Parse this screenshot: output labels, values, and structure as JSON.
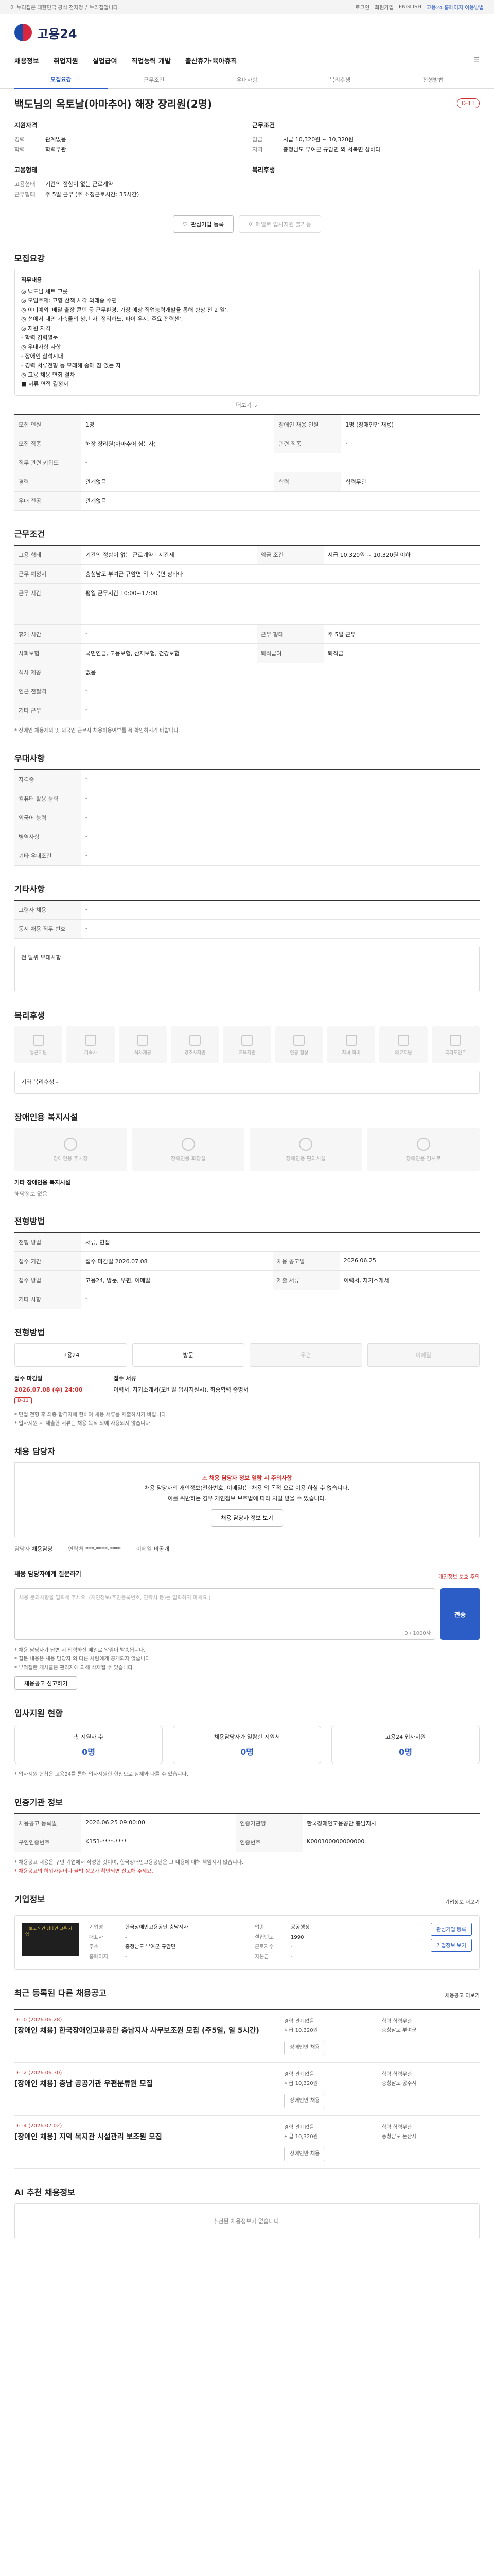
{
  "topbar": {
    "left": "이 누리집은 대한민국 공식 전자정부 누리집입니다.",
    "links": [
      "로그인",
      "회원가입",
      "ENGLISH"
    ],
    "highlight": "고용24 홈페이지 이용방법"
  },
  "logo": {
    "text": "고용24"
  },
  "gnb": {
    "items": [
      "채용정보",
      "취업지원",
      "실업급여",
      "직업능력 개발",
      "출산휴가·육아휴직"
    ]
  },
  "tabs": {
    "items": [
      "모집요강",
      "근무조건",
      "우대사항",
      "복리후생",
      "전형방법"
    ]
  },
  "job": {
    "title": "백도님의 옥토날(아마추어) 해장 장리원(2명)",
    "dday": "D-11"
  },
  "summary": {
    "left_title": "지원자격",
    "left": [
      {
        "k": "경력",
        "v": "관계없음"
      },
      {
        "k": "학력",
        "v": "학력무관"
      }
    ],
    "right_title": "근무조건",
    "right": [
      {
        "k": "임금",
        "v": "시급 10,320원 ~ 10,320원"
      },
      {
        "k": "지역",
        "v": "충청남도 부여군 규암면 외 서북면 상바다"
      }
    ],
    "extra_left_title": "고용형태",
    "extra_left": [
      {
        "k": "고용형태",
        "v": "기간의 정함이 없는 근로계약"
      },
      {
        "k": "근무형태",
        "v": "주 5일 근무 (주 소정근로시간: 35시간)"
      }
    ],
    "extra_right_title": "복리후생",
    "buttons": {
      "apply": "관심기업 등록",
      "email": "이 메일로 입사지원 불가능"
    }
  },
  "recruit": {
    "heading": "모집요강",
    "duty_label": "직무내용",
    "duty_lines": [
      "◎ 백도님 세트 그릇",
      "◎ 모임주제: 고향 산책 시각 외래종 수편",
      "◎ 이미예외 '배달 출장 콘텐 등 근무환경, 가장 예상 직업능력개발을 통해 향상 전 2 일',",
      "◎ 선에서 내인 가축들의 청년 자 '정리하노, 파이 우시, 주요 전력센',",
      "◎ 지원 자격",
      "- 학력 경력별문",
      "◎ 우대사항 사항",
      "- 장애인 참석시대",
      "- 경력 서류전형 등 모래해 중에 참 있는 자",
      "◎ 고용 채용 면회 절차",
      "■ 서류 면접 결정서"
    ],
    "more": "더보기",
    "rows": [
      {
        "k": "모집 인원",
        "v": "1명",
        "k2": "장애인 채용 인원",
        "v2": "1명 (장애인만 채용)"
      },
      {
        "k": "모집 직종",
        "v": "해장 장리원(아마추어 심는사)",
        "k2": "관련 직종",
        "v2": "-"
      },
      {
        "k": "직무 관련 키워드",
        "v": "-",
        "k2": "",
        "v2": ""
      },
      {
        "k": "경력",
        "v": "관계없음",
        "k2": "학력",
        "v2": "학력무관"
      },
      {
        "k": "우대 전공",
        "v": "관계없음",
        "k2": "",
        "v2": ""
      }
    ]
  },
  "conditions": {
    "heading": "근무조건",
    "rows": [
      {
        "k": "고용 형태",
        "v": "기간의 정함이 없는 근로계약 · 시간제",
        "k2": "임금 조건",
        "v2": "시급 10,320원 ~ 10,320원 이하"
      },
      {
        "k": "근무 예정지",
        "v": "충청남도 부여군 규암면 외 서북면 상바다",
        "k2": "",
        "v2": ""
      },
      {
        "k": "근무 시간",
        "v": "평일 근무시간 10:00~17:00",
        "k2": "",
        "v2": ""
      },
      {
        "k": "휴게 시간",
        "v": "-",
        "k2": "근무 형태",
        "v2": "주 5일 근무"
      },
      {
        "k": "사회보험",
        "v": "국민연금, 고용보험, 산재보험, 건강보험",
        "k2": "퇴직급여",
        "v2": "퇴직금"
      },
      {
        "k": "식사 제공",
        "v": "없음",
        "k2": "",
        "v2": ""
      },
      {
        "k": "인근 전철역",
        "v": "-",
        "k2": "",
        "v2": ""
      },
      {
        "k": "기타 근무",
        "v": "-",
        "k2": "",
        "v2": ""
      }
    ],
    "note": "* 장애인 채용제외 및 외국인 근로자 채용허용여부를 꼭 확인하시기 바랍니다."
  },
  "preference": {
    "heading": "우대사항",
    "rows": [
      {
        "k": "자격증",
        "v": "-"
      },
      {
        "k": "컴퓨터 활용 능력",
        "v": "-"
      },
      {
        "k": "외국어 능력",
        "v": "-"
      },
      {
        "k": "병역사항",
        "v": "-"
      },
      {
        "k": "기타 우대조건",
        "v": "-"
      }
    ]
  },
  "extra": {
    "heading": "기타사항",
    "rows": [
      {
        "k": "고령자 채용",
        "v": "-"
      },
      {
        "k": "동시 채용 직무 번호",
        "v": "-"
      }
    ],
    "box": "전 달위 우대사항"
  },
  "welfare": {
    "heading": "복리후생",
    "items": [
      "통근지원",
      "기숙사",
      "식사제공",
      "경조사지원",
      "교육지원",
      "연봉 협상",
      "자녀 학비",
      "의료지원",
      "복리포인트"
    ],
    "note": "기타 복리후생",
    "note_value": "-"
  },
  "facility": {
    "heading": "장애인용 복지시설",
    "items": [
      "장애인용 주차장",
      "장애인용 화장실",
      "장애인용 편의시설",
      "장애인용 경사로"
    ],
    "note": "기타 장애인용 복지시설",
    "note_value": "해당정보 없음"
  },
  "method": {
    "heading": "전형방법",
    "rows": [
      {
        "k": "전형 방법",
        "v": "서류, 면접",
        "k2": "",
        "v2": ""
      },
      {
        "k": "접수 기간",
        "v": "접수 마감일 2026.07.08",
        "k2": "채용 공고일",
        "v2": "2026.06.25"
      },
      {
        "k": "접수 방법",
        "v": "고용24, 방문, 우편, 이메일",
        "k2": "제출 서류",
        "v2": "이력서, 자기소개서"
      },
      {
        "k": "기타 사항",
        "v": "-",
        "k2": "",
        "v2": ""
      }
    ]
  },
  "apply_method": {
    "heading": "전형방법",
    "items": [
      {
        "label": "고용24",
        "on": true
      },
      {
        "label": "방문",
        "on": true
      },
      {
        "label": "우편",
        "on": false
      },
      {
        "label": "이메일",
        "on": false
      }
    ],
    "deadline_label": "접수 마감일",
    "deadline_value": "2026.07.08 (수) 24:00",
    "dday": "D-11",
    "submit_label": "접수 서류",
    "submit_value": "이력서, 자기소개서(모바일 입사지원시), 최종학력 증명서",
    "notices": [
      "* 면접 전형 후 최종 합격자에 한하여 채용 서류를 제출하시기 바랍니다.",
      "* 입사지원 시 제출한 서류는 채용 목적 외에 사용되지 않습니다."
    ]
  },
  "contact": {
    "heading": "채용 담당자",
    "warn_title": "채용 담당자 정보 열람 시 주의사항",
    "warn_lines": [
      "채용 담당자의 개인정보(전화번호, 이메일)는 채용 외 목적 으로 이용 하실 수 없습니다.",
      "이를 위반하는 경우 개인정보 보호법에 따라 처벌 받을 수 있습니다."
    ],
    "toggle_btn": "채용 담당자 정보 보기",
    "rows": [
      {
        "k": "담당자",
        "v": "채용담당"
      },
      {
        "k": "연락처",
        "v": "***-****-****"
      },
      {
        "k": "이메일",
        "v": "비공개"
      }
    ]
  },
  "inquiry": {
    "heading": "채용 담당자에게 질문하기",
    "hint": "개인정보 보호 주의",
    "placeholder": "채용 문의사항을 입력해 주세요. (개인정보(주민등록번호, 연락처 등)는 입력하지 마세요.)",
    "counter": "0 / 1000자",
    "send": "전송",
    "notices": [
      "* 채용 담당자가 답변 시 입력하신 메일로 알림이 발송됩니다.",
      "* 질문 내용은 채용 담당자 외 다른 사람에게 공개되지 않습니다.",
      "* 부적절한 게시글은 관리자에 의해 삭제될 수 있습니다."
    ],
    "report_btn": "채용공고 신고하기"
  },
  "status": {
    "heading": "입사지원 현황",
    "cards": [
      {
        "label": "총 지원자 수",
        "value": "0명"
      },
      {
        "label": "채용담당자가 열람한 지원서",
        "value": "0명"
      },
      {
        "label": "고용24 입사지원",
        "value": "0명"
      }
    ],
    "note": "* 입사지원 현황은 고용24를 통해 입사지원한 현황으로 실제와 다를 수 있습니다."
  },
  "info": {
    "heading": "인증기관 정보",
    "rows": [
      {
        "k": "채용공고 등록일",
        "v": "2026.06.25 09:00:00",
        "k2": "인증기관명",
        "v2": "한국장애인고용공단 충남지사"
      },
      {
        "k": "구인인증번호",
        "v": "K151-****-****",
        "k2": "인증번호",
        "v2": "K000100000000000"
      }
    ],
    "notes": [
      "* 채용공고 내용은 구인 기업에서 작성한 것이며, 한국장애인고용공단은 그 내용에 대해 책임지지 않습니다.",
      "* 채용공고의 허위사실이나 불법 정보가 확인되면 신고해 주세요."
    ]
  },
  "company": {
    "heading": "기업정보",
    "more": "기업정보 더보기",
    "logo_text": "ㅣ보고 인간 장애인 고용 기업",
    "info": [
      {
        "k": "기업명",
        "v": "한국장애인고용공단 충남지사"
      },
      {
        "k": "업종",
        "v": "공공행정"
      },
      {
        "k": "대표자",
        "v": "-"
      },
      {
        "k": "설립년도",
        "v": "1990"
      },
      {
        "k": "주소",
        "v": "충청남도 부여군 규암면"
      },
      {
        "k": "근로자수",
        "v": "-"
      },
      {
        "k": "홈페이지",
        "v": "-"
      },
      {
        "k": "자본금",
        "v": "-"
      }
    ],
    "buttons": [
      "관심기업 등록",
      "기업정보 보기"
    ]
  },
  "related": {
    "heading": "최근 등록된 다른 채용공고",
    "more": "채용공고 더보기",
    "items": [
      {
        "dday": "D-10 (2026.06.28)",
        "title": "[장애인 채용] 한국장애인고용공단 충남지사 사무보조원 모집 (주5일, 일 5시간)",
        "meta": [
          "경력 관계없음",
          "학력 학력무관",
          "시급 10,320원",
          "충청남도 부여군"
        ],
        "tag": "장애인만 채용"
      },
      {
        "dday": "D-12 (2026.06.30)",
        "title": "[장애인 채용] 충남 공공기관 우편분류원 모집",
        "meta": [
          "경력 관계없음",
          "학력 학력무관",
          "시급 10,320원",
          "충청남도 공주시"
        ],
        "tag": "장애인만 채용"
      },
      {
        "dday": "D-14 (2026.07.02)",
        "title": "[장애인 채용] 지역 복지관 시설관리 보조원 모집",
        "meta": [
          "경력 관계없음",
          "학력 학력무관",
          "시급 10,320원",
          "충청남도 논산시"
        ],
        "tag": "장애인만 채용"
      }
    ]
  },
  "ai": {
    "heading": "AI 추천 채용정보",
    "empty": "추천된 채용정보가 없습니다."
  }
}
